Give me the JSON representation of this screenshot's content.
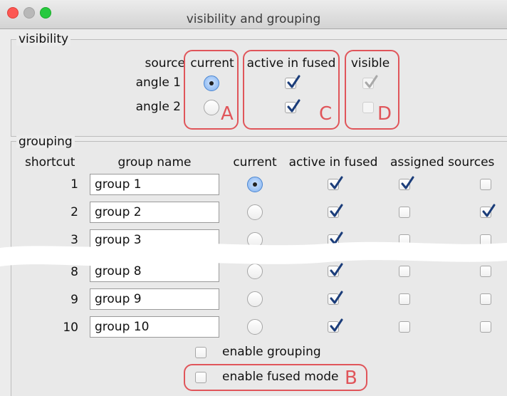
{
  "window": {
    "title": "visibility and grouping"
  },
  "visibility": {
    "legend": "visibility",
    "headers": {
      "source": "source",
      "current": "current",
      "active": "active in fused",
      "visible": "visible"
    },
    "rows": [
      {
        "label": "angle 1",
        "current": true,
        "active": true,
        "visible": true
      },
      {
        "label": "angle 2",
        "current": false,
        "active": true,
        "visible": false
      }
    ]
  },
  "grouping": {
    "legend": "grouping",
    "headers": {
      "shortcut": "shortcut",
      "name": "group name",
      "current": "current",
      "active": "active in fused",
      "assigned": "assigned sources"
    },
    "rows": [
      {
        "shortcut": "1",
        "name": "group 1",
        "current": true,
        "active": true,
        "assigned1": true,
        "assigned2": false
      },
      {
        "shortcut": "2",
        "name": "group 2",
        "current": false,
        "active": true,
        "assigned1": false,
        "assigned2": true
      },
      {
        "shortcut": "3",
        "name": "group 3",
        "current": false,
        "active": true,
        "assigned1": false,
        "assigned2": false
      },
      {
        "shortcut": "8",
        "name": "group 8",
        "current": false,
        "active": true,
        "assigned1": false,
        "assigned2": false
      },
      {
        "shortcut": "9",
        "name": "group 9",
        "current": false,
        "active": true,
        "assigned1": false,
        "assigned2": false
      },
      {
        "shortcut": "10",
        "name": "group 10",
        "current": false,
        "active": true,
        "assigned1": false,
        "assigned2": false
      }
    ],
    "enable_grouping": {
      "label": "enable grouping",
      "checked": false
    },
    "enable_fused": {
      "label": "enable fused mode",
      "checked": false
    }
  },
  "annotations": {
    "a": "A",
    "b": "B",
    "c": "C",
    "d": "D"
  },
  "colors": {
    "highlight": "#e0555a",
    "check": "#1b3d7a",
    "radio_selected": "#7fb0ee"
  }
}
